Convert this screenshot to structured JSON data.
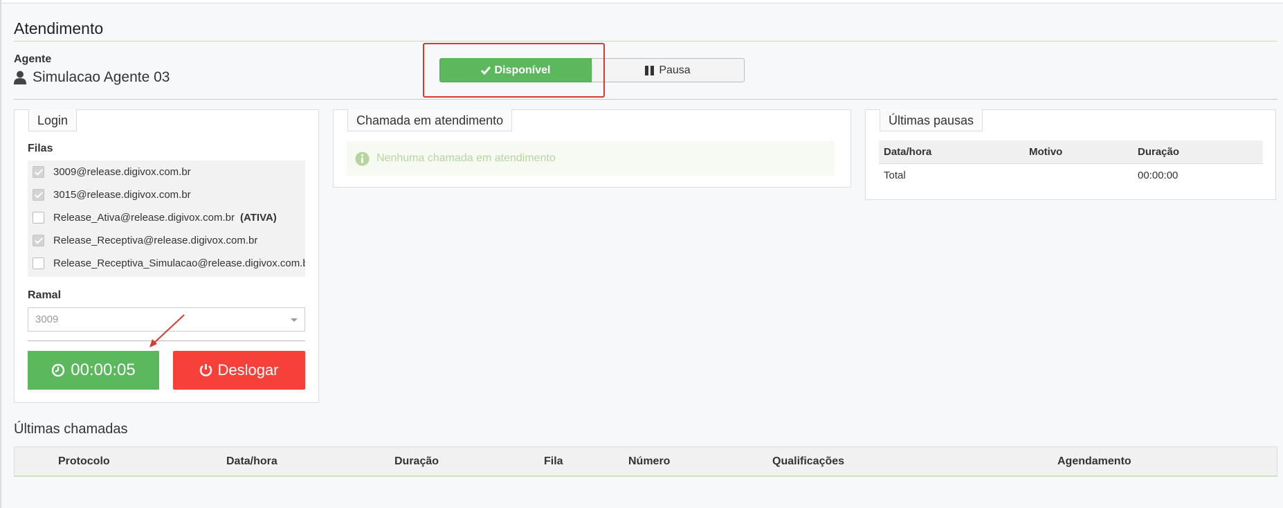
{
  "page": {
    "title": "Atendimento"
  },
  "agent": {
    "label": "Agente",
    "name": "Simulacao Agente 03"
  },
  "status": {
    "available_label": "Disponível",
    "pause_label": "Pausa",
    "available_color": "#5cb85c"
  },
  "login": {
    "tab": "Login",
    "filas_label": "Filas",
    "filas": [
      {
        "name": "3009@release.digivox.com.br",
        "checked": true,
        "tag": ""
      },
      {
        "name": "3015@release.digivox.com.br",
        "checked": true,
        "tag": ""
      },
      {
        "name": "Release_Ativa@release.digivox.com.br",
        "checked": false,
        "tag": "(ATIVA)"
      },
      {
        "name": "Release_Receptiva@release.digivox.com.br",
        "checked": true,
        "tag": ""
      },
      {
        "name": "Release_Receptiva_Simulacao@release.digivox.com.br",
        "checked": false,
        "tag": ""
      }
    ],
    "ramal_label": "Ramal",
    "ramal_value": "3009",
    "timer": "00:00:05",
    "logout_label": "Deslogar",
    "logout_color": "#f8403a"
  },
  "call": {
    "tab": "Chamada em atendimento",
    "empty_message": "Nenhuma chamada em atendimento"
  },
  "pauses": {
    "tab": "Últimas pausas",
    "headers": [
      "Data/hora",
      "Motivo",
      "Duração"
    ],
    "total_label": "Total",
    "total_duration": "00:00:00"
  },
  "calls": {
    "title": "Últimas chamadas",
    "headers": [
      "Protocolo",
      "Data/hora",
      "Duração",
      "Fila",
      "Número",
      "Qualificações",
      "Agendamento"
    ]
  },
  "icons": [
    "user-icon",
    "check-icon",
    "pause-icon",
    "clock-icon",
    "power-icon",
    "info-icon",
    "caret-down-icon"
  ]
}
